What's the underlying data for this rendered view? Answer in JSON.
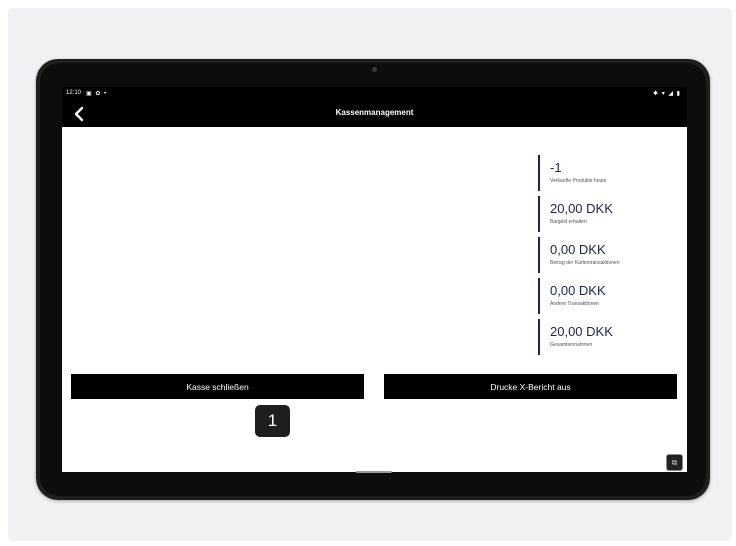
{
  "statusbar": {
    "time": "12:10",
    "left_icons": "▣ ✿ •",
    "right_icons": "✱ ▾ ◢ ▮"
  },
  "appbar": {
    "title": "Kassenmanagement",
    "back_icon": "chevron-left-icon"
  },
  "stats": [
    {
      "value": "-1",
      "label": "Verkaufte Produkte heute"
    },
    {
      "value": "20,00 DKK",
      "label": "Bargeld erhalten"
    },
    {
      "value": "0,00 DKK",
      "label": "Betrag der Kartentransaktionen"
    },
    {
      "value": "0,00 DKK",
      "label": "Andere Transaktionen"
    },
    {
      "value": "20,00 DKK",
      "label": "Gesamteinnahmen"
    }
  ],
  "buttons": {
    "close_register": "Kasse schließen",
    "print_x_report": "Drucke X-Bericht aus"
  },
  "step_badge": "1",
  "side_icon": "⧉",
  "colors": {
    "accent": "#1c2450",
    "bar": "#000000"
  }
}
